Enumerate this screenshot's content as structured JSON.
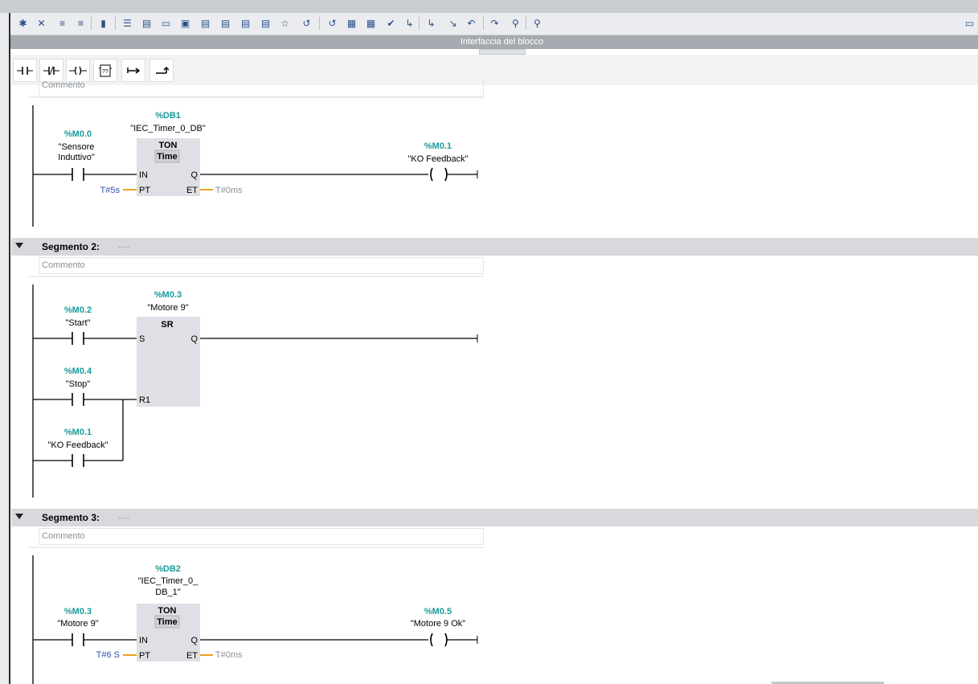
{
  "header": {
    "interface_title": "Interfaccia del blocco"
  },
  "toolbar": {
    "icons": [
      "insert-network-icon",
      "delete-network-icon",
      "insert-row-icon",
      "append-row-icon",
      "network-navigate-icon",
      "absolute-operands-icon",
      "display-symbols-icon",
      "display-address-icon",
      "show-comments-icon",
      "favorites-icon",
      "monitor-icon",
      "go-online-icon",
      "breakpoint-icon",
      "clear-breakpoints-icon",
      "snapshot-icon",
      "download-icon",
      "compare-icon",
      "watch-table-icon",
      "force-icon",
      "modify-icon",
      "cross-ref-icon",
      "call-structure-icon",
      "assignment-icon",
      "settings-icon",
      "trace-icon",
      "database-icon"
    ]
  },
  "ladder_toolbar": {
    "items": [
      {
        "name": "no-contact-icon",
        "label": "-| |-"
      },
      {
        "name": "nc-contact-icon",
        "label": "-|/|-"
      },
      {
        "name": "coil-icon",
        "label": "-( )-"
      },
      {
        "name": "empty-box-icon",
        "label": "??"
      },
      {
        "name": "open-branch-icon",
        "label": "↦"
      },
      {
        "name": "close-branch-icon",
        "label": "↱"
      }
    ]
  },
  "segments": [
    {
      "comment": "Commento",
      "rungs": {
        "db": {
          "address": "%DB1",
          "symbol": "\"IEC_Timer_0_DB\""
        },
        "box": {
          "type": "TON",
          "subtype": "Time",
          "pin_in": "IN",
          "pin_pt": "PT",
          "pin_q": "Q",
          "pin_et": "ET"
        },
        "contact": {
          "address": "%M0.0",
          "symbol_line1": "\"Sensore",
          "symbol_line2": "Induttivo\""
        },
        "coil": {
          "address": "%M0.1",
          "symbol": "\"KO Feedback\""
        },
        "pt_value": "T#5s",
        "et_value": "T#0ms"
      }
    },
    {
      "title": "Segmento 2:",
      "dots": ".....",
      "comment": "Commento",
      "rungs": {
        "instance": {
          "address": "%M0.3",
          "symbol": "\"Motore 9\""
        },
        "box": {
          "type": "SR",
          "pin_s": "S",
          "pin_q": "Q",
          "pin_r1": "R1"
        },
        "contact1": {
          "address": "%M0.2",
          "symbol": "\"Start\""
        },
        "contact2": {
          "address": "%M0.4",
          "symbol": "\"Stop\""
        },
        "contact3": {
          "address": "%M0.1",
          "symbol": "\"KO Feedback\""
        }
      }
    },
    {
      "title": "Segmento 3:",
      "dots": ".....",
      "comment": "Commento",
      "rungs": {
        "db": {
          "address": "%DB2",
          "symbol_line1": "\"IEC_Timer_0_",
          "symbol_line2": "DB_1\""
        },
        "box": {
          "type": "TON",
          "subtype": "Time",
          "pin_in": "IN",
          "pin_pt": "PT",
          "pin_q": "Q",
          "pin_et": "ET"
        },
        "contact": {
          "address": "%M0.3",
          "symbol": "\"Motore 9\""
        },
        "coil": {
          "address": "%M0.5",
          "symbol": "\"Motore 9 Ok\""
        },
        "pt_value": "T#6 S",
        "et_value": "T#0ms"
      }
    }
  ],
  "colors": {
    "address": "#1a9a9a",
    "literal": "#2f52a6",
    "segment_header": "#d7d9dc",
    "box_fill": "#dfe0e6",
    "pin_wire": "#f0a020"
  }
}
